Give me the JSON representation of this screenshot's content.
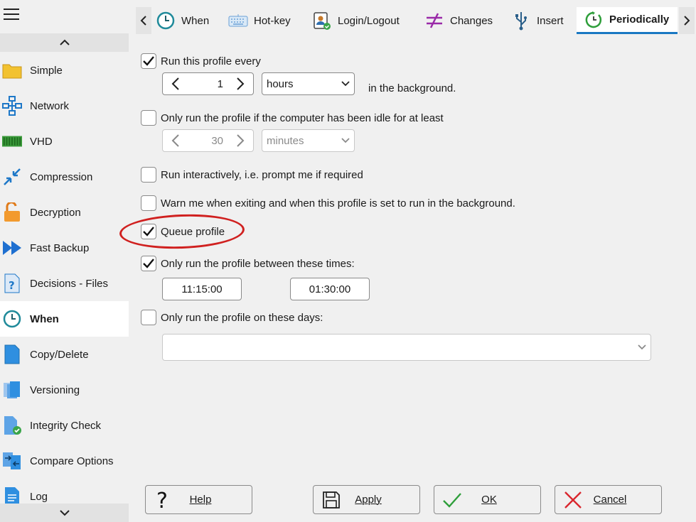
{
  "sidebar": {
    "items": [
      {
        "label": "Simple",
        "icon": "folder-icon"
      },
      {
        "label": "Network",
        "icon": "network-icon"
      },
      {
        "label": "VHD",
        "icon": "vhd-drive-icon"
      },
      {
        "label": "Compression",
        "icon": "compress-arrows-icon"
      },
      {
        "label": "Decryption",
        "icon": "padlock-open-icon"
      },
      {
        "label": "Fast Backup",
        "icon": "fast-forward-icon"
      },
      {
        "label": "Decisions - Files",
        "icon": "question-document-icon"
      },
      {
        "label": "When",
        "icon": "clock-icon",
        "active": true
      },
      {
        "label": "Copy/Delete",
        "icon": "copy-document-icon"
      },
      {
        "label": "Versioning",
        "icon": "versions-icon"
      },
      {
        "label": "Integrity Check",
        "icon": "document-check-icon"
      },
      {
        "label": "Compare Options",
        "icon": "compare-icon"
      },
      {
        "label": "Log",
        "icon": "log-document-icon"
      }
    ]
  },
  "tabs": [
    {
      "label": "When",
      "icon": "clock-icon"
    },
    {
      "label": "Hot-key",
      "icon": "keyboard-icon"
    },
    {
      "label": "Login/Logout",
      "icon": "user-badge-icon"
    },
    {
      "label": "Changes",
      "icon": "not-equal-icon"
    },
    {
      "label": "Insert",
      "icon": "usb-icon"
    },
    {
      "label": "Periodically",
      "icon": "refresh-clock-icon",
      "active": true
    }
  ],
  "options": {
    "run_every": {
      "label": "Run this profile every",
      "checked": true,
      "value": "1",
      "unit": "hours",
      "suffix": "in the background."
    },
    "idle": {
      "label": "Only run the profile if the computer has been idle for at least",
      "checked": false,
      "value": "30",
      "unit": "minutes"
    },
    "interactive": {
      "label": "Run interactively, i.e. prompt me if required",
      "checked": false
    },
    "warn": {
      "label": "Warn me when exiting and when this profile is set to run in the background.",
      "checked": false
    },
    "queue": {
      "label": "Queue profile",
      "checked": true
    },
    "between_times": {
      "label": "Only run the profile between these times:",
      "checked": true,
      "start": "11:15:00",
      "end": "01:30:00"
    },
    "days": {
      "label": "Only run the profile on these days:",
      "checked": false,
      "value": ""
    }
  },
  "buttons": {
    "help": "Help",
    "apply": "Apply",
    "ok": "OK",
    "cancel": "Cancel"
  },
  "colors": {
    "accent": "#1a78c2",
    "highlight": "#d0201f",
    "ok_green": "#2e9e3a",
    "cancel_red": "#d9272e"
  }
}
